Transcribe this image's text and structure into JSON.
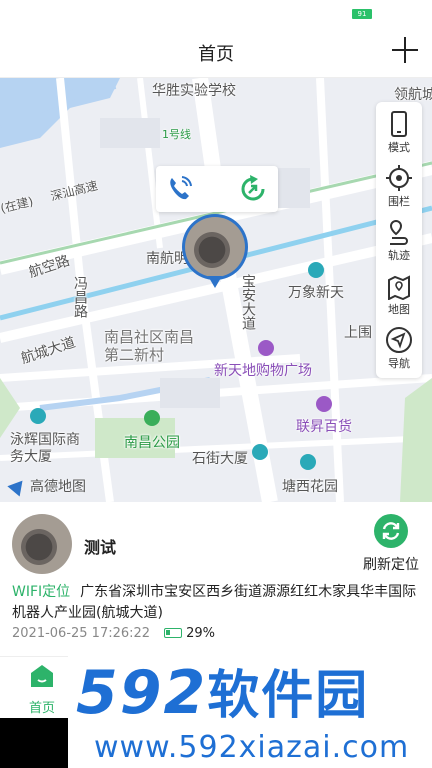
{
  "status_bar": {
    "battery": "91"
  },
  "header": {
    "title": "首页",
    "add_icon": "plus-icon"
  },
  "map": {
    "labels": {
      "school": "华胜实验学校",
      "lingxin": "领航城",
      "metro": "1号线",
      "airport_rd": "航空路",
      "hangcheng_avenue": "航城大道",
      "nanhang": "南航明",
      "xiangcheng_rd": "冯昌路",
      "baoan_avenue": "宝安大道",
      "wanxiang": "万象新天",
      "shanghe": "上围",
      "shequ": "南昌社区南昌第二新村",
      "xintiandi": "新天地购物广场",
      "lianbang": "联昇百货",
      "yonghui": "泳辉国际商务大厦",
      "nanchang_park": "南昌公园",
      "shijie": "石街大厦",
      "tangxi": "塘西花园",
      "expressway": "深汕高速",
      "jian": "(在建)"
    },
    "callout_icons": [
      "phone-icon",
      "refresh-icon"
    ],
    "tools": [
      {
        "label": "模式",
        "icon": "phone-mode-icon"
      },
      {
        "label": "围栏",
        "icon": "fence-icon"
      },
      {
        "label": "轨迹",
        "icon": "track-icon"
      },
      {
        "label": "地图",
        "icon": "map-icon"
      },
      {
        "label": "导航",
        "icon": "navigation-icon"
      }
    ],
    "logo": "高德地图"
  },
  "device": {
    "name": "测试",
    "refresh_label": "刷新定位",
    "location_type": "WIFI定位",
    "address": "广东省深圳市宝安区西乡街道源源红红木家具华丰国际机器人产业园(航城大道)",
    "time": "2021-06-25 17:26:22",
    "battery_percent": "29%"
  },
  "tabbar": {
    "home_label": "首页"
  },
  "watermark": {
    "main_digits": "592",
    "main_cn": "软件园",
    "url": "www.592xiazai.com"
  },
  "colors": {
    "accent": "#2db36a",
    "pin": "#2c73c9",
    "watermark": "#1e6fd4"
  }
}
